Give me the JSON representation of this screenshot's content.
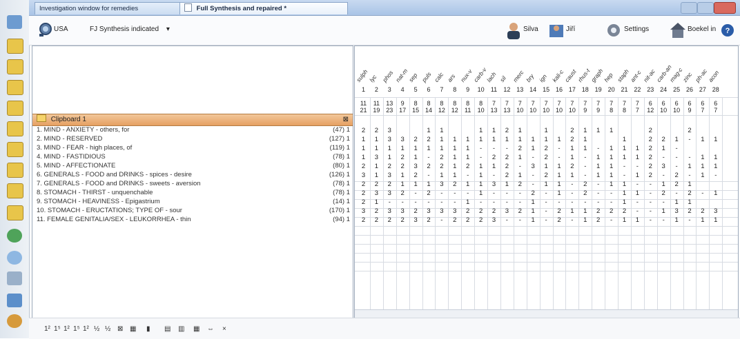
{
  "window": {
    "tab_inactive": "Investigation window for remedies",
    "tab_active": "Full Synthesis and repaired *"
  },
  "toolbar": {
    "usa_label": "USA",
    "book_label": "FJ Synthesis indicated",
    "book_arrow": "▾",
    "user1_label": "Silva",
    "user2_label": "Jiří",
    "settings_label": "Settings",
    "bookmarks_label": "Boekel in",
    "help_label": "?"
  },
  "clipboard": {
    "title": "Clipboard 1",
    "close": "⊠"
  },
  "rubrics": [
    {
      "label": "1. MIND - ANXIETY - others, for",
      "count": "(47) 1"
    },
    {
      "label": "2. MIND - RESERVED",
      "count": "(127) 1"
    },
    {
      "label": "3. MIND - FEAR - high places, of",
      "count": "(119) 1"
    },
    {
      "label": "4. MIND - FASTIDIOUS",
      "count": "(78) 1"
    },
    {
      "label": "5. MIND - AFFECTIONATE",
      "count": "(80) 1"
    },
    {
      "label": "6. GENERALS - FOOD and DRINKS - spices - desire",
      "count": "(126) 1"
    },
    {
      "label": "7. GENERALS - FOOD and DRINKS - sweets - aversion",
      "count": "(78) 1"
    },
    {
      "label": "8. STOMACH - THIRST - unquenchable",
      "count": "(78) 1"
    },
    {
      "label": "9. STOMACH - HEAVINESS - Epigastrium",
      "count": "(14) 1"
    },
    {
      "label": "10. STOMACH - ERUCTATIONS; TYPE OF - sour",
      "count": "(170) 1"
    },
    {
      "label": "11. FEMALE GENITALIA/SEX - LEUKORRHEA - thin",
      "count": "(94) 1"
    }
  ],
  "remedies": {
    "names": [
      "sulph",
      "lyc",
      "phos",
      "nat-m",
      "sep",
      "puls",
      "calc",
      "ars",
      "nux-v",
      "carb-v",
      "lach",
      "sil",
      "merc",
      "bry",
      "ign",
      "kali-c",
      "caust",
      "rhus-t",
      "graph",
      "hep",
      "staph",
      "ant-c",
      "nit-ac",
      "carb-an",
      "mag-c",
      "zinc",
      "ph-ac",
      "acon"
    ],
    "numbers": [
      "1",
      "2",
      "3",
      "4",
      "5",
      "6",
      "7",
      "8",
      "9",
      "10",
      "11",
      "12",
      "13",
      "14",
      "15",
      "16",
      "17",
      "18",
      "19",
      "20",
      "21",
      "22",
      "23",
      "24",
      "25",
      "26",
      "27",
      "28"
    ],
    "totals_top": [
      "11",
      "11",
      "13",
      "9",
      "8",
      "8",
      "8",
      "8",
      "8",
      "8",
      "7",
      "7",
      "7",
      "7",
      "7",
      "7",
      "7",
      "7",
      "7",
      "7",
      "7",
      "7",
      "6",
      "6",
      "6",
      "6",
      "6",
      "6"
    ],
    "totals_bottom": [
      "21",
      "19",
      "23",
      "17",
      "15",
      "14",
      "12",
      "12",
      "11",
      "10",
      "13",
      "13",
      "10",
      "10",
      "10",
      "10",
      "10",
      "9",
      "9",
      "8",
      "8",
      "7",
      "12",
      "10",
      "10",
      "9",
      "7",
      "7"
    ]
  },
  "grid": [
    [
      "2",
      "2",
      "3",
      "",
      "",
      "1",
      "1",
      "",
      "",
      "1",
      "1",
      "2",
      "1",
      "",
      "1",
      "",
      "2",
      "1",
      "1",
      "1",
      "",
      "",
      "2",
      "",
      "",
      "2",
      "",
      ""
    ],
    [
      "1",
      "1",
      "3",
      "3",
      "2",
      "2",
      "1",
      "1",
      "1",
      "1",
      "1",
      "1",
      "1",
      "1",
      "1",
      "1",
      "2",
      "1",
      "",
      "",
      "1",
      "",
      "2",
      "2",
      "1",
      "-",
      "1",
      "1"
    ],
    [
      "1",
      "1",
      "1",
      "1",
      "1",
      "1",
      "1",
      "1",
      "1",
      "-",
      "-",
      "-",
      "2",
      "1",
      "2",
      "-",
      "1",
      "1",
      "-",
      "1",
      "1",
      "1",
      "2",
      "1",
      "-",
      "",
      "",
      ""
    ],
    [
      "1",
      "3",
      "1",
      "2",
      "1",
      "-",
      "2",
      "1",
      "1",
      "-",
      "2",
      "2",
      "1",
      "-",
      "2",
      "-",
      "1",
      "-",
      "1",
      "1",
      "1",
      "1",
      "2",
      "-",
      "-",
      "-",
      "1",
      "1"
    ],
    [
      "2",
      "1",
      "2",
      "2",
      "3",
      "2",
      "2",
      "1",
      "2",
      "1",
      "1",
      "2",
      "-",
      "3",
      "1",
      "1",
      "2",
      "-",
      "1",
      "1",
      "-",
      "-",
      "2",
      "3",
      "-",
      "1",
      "1",
      "1"
    ],
    [
      "3",
      "1",
      "3",
      "1",
      "2",
      "-",
      "1",
      "1",
      "-",
      "1",
      "-",
      "2",
      "1",
      "-",
      "2",
      "1",
      "1",
      "-",
      "1",
      "1",
      "-",
      "1",
      "2",
      "-",
      "2",
      "-",
      "1",
      "-"
    ],
    [
      "2",
      "2",
      "2",
      "1",
      "1",
      "1",
      "3",
      "2",
      "1",
      "1",
      "3",
      "1",
      "2",
      "-",
      "1",
      "1",
      "-",
      "2",
      "-",
      "1",
      "1",
      "-",
      "-",
      "1",
      "2",
      "1",
      "",
      ""
    ],
    [
      "2",
      "3",
      "3",
      "2",
      "-",
      "2",
      "-",
      "-",
      "-",
      "1",
      "-",
      "-",
      "-",
      "2",
      "-",
      "1",
      "-",
      "2",
      "-",
      "-",
      "1",
      "1",
      "-",
      "2",
      "-",
      "2",
      "-",
      "1"
    ],
    [
      "2",
      "1",
      "-",
      "-",
      "-",
      "-",
      "-",
      "-",
      "1",
      "-",
      "-",
      "-",
      "-",
      "1",
      "-",
      "-",
      "-",
      "-",
      "-",
      "-",
      "1",
      "-",
      "-",
      "-",
      "1",
      "1",
      "",
      ""
    ],
    [
      "3",
      "2",
      "3",
      "3",
      "2",
      "3",
      "3",
      "3",
      "2",
      "2",
      "2",
      "3",
      "2",
      "1",
      "-",
      "2",
      "1",
      "1",
      "2",
      "2",
      "2",
      "-",
      "-",
      "1",
      "3",
      "2",
      "2",
      "3"
    ],
    [
      "2",
      "2",
      "2",
      "2",
      "3",
      "2",
      "-",
      "2",
      "2",
      "2",
      "3",
      "-",
      "-",
      "1",
      "-",
      "2",
      "-",
      "1",
      "2",
      "-",
      "1",
      "1",
      "-",
      "-",
      "1",
      "-",
      "1",
      "1"
    ]
  ],
  "bottom_toolbar": [
    "1²",
    "1⁵",
    "1²",
    "1⁵",
    "1²",
    "½",
    "½",
    "⊠",
    "▦",
    "▮",
    "▤",
    "▥",
    "▦",
    "⇔",
    "×"
  ],
  "colors": {
    "accent": "#a9c4e6",
    "clipboard_header": "#e6a062",
    "grid_line": "#d7dbe2"
  }
}
